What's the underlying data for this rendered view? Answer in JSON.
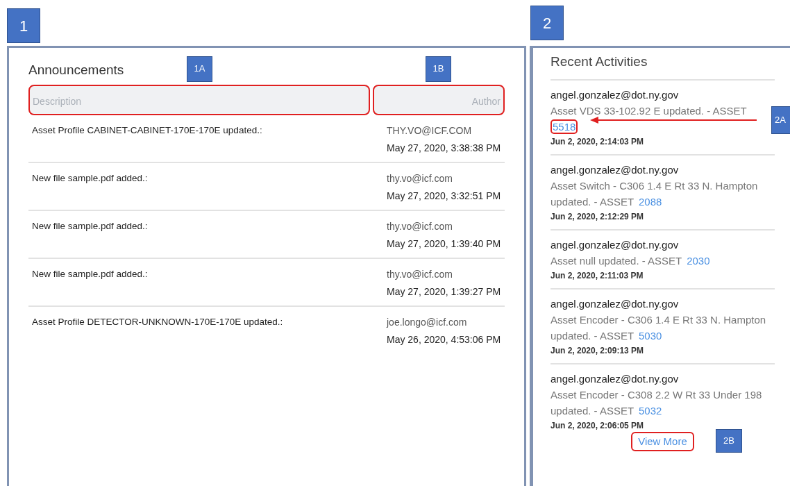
{
  "announcements": {
    "callout": "1",
    "title": "Announcements",
    "columns": [
      {
        "label": "Description",
        "callout": "1A",
        "highlighted": true
      },
      {
        "label": "Author",
        "callout": "1B",
        "highlighted": true
      }
    ],
    "rows": [
      {
        "description": "Asset Profile CABINET-CABINET-170E-170E updated.:",
        "author": "THY.VO@ICF.COM",
        "date": "May 27, 2020, 3:38:38 PM"
      },
      {
        "description": "New file sample.pdf added.:",
        "author": "thy.vo@icf.com",
        "date": "May 27, 2020, 3:32:51 PM"
      },
      {
        "description": "New file sample.pdf added.:",
        "author": "thy.vo@icf.com",
        "date": "May 27, 2020, 1:39:40 PM"
      },
      {
        "description": "New file sample.pdf added.:",
        "author": "thy.vo@icf.com",
        "date": "May 27, 2020, 1:39:27 PM"
      },
      {
        "description": "Asset Profile DETECTOR-UNKNOWN-170E-170E updated.:",
        "author": "joe.longo@icf.com",
        "date": "May 26, 2020, 4:53:06 PM"
      }
    ]
  },
  "activities": {
    "callout": "2",
    "title": "Recent Activities",
    "items": [
      {
        "user": "angel.gonzalez@dot.ny.gov",
        "text": "Asset VDS 33-102.92 E updated. - ASSET",
        "asset": "5518",
        "highlighted": true,
        "callout": "2A",
        "date": "Jun 2, 2020, 2:14:03 PM"
      },
      {
        "user": "angel.gonzalez@dot.ny.gov",
        "text": "Asset Switch - C306 1.4 E Rt 33 N. Hampton updated. - ASSET",
        "asset": "2088",
        "highlighted": false,
        "date": "Jun 2, 2020, 2:12:29 PM"
      },
      {
        "user": "angel.gonzalez@dot.ny.gov",
        "text": "Asset null updated. - ASSET",
        "asset": "2030",
        "highlighted": false,
        "date": "Jun 2, 2020, 2:11:03 PM"
      },
      {
        "user": "angel.gonzalez@dot.ny.gov",
        "text": "Asset Encoder - C306 1.4 E Rt 33 N. Hampton updated. - ASSET",
        "asset": "5030",
        "highlighted": false,
        "date": "Jun 2, 2020, 2:09:13 PM"
      },
      {
        "user": "angel.gonzalez@dot.ny.gov",
        "text": "Asset Encoder - C308 2.2 W Rt 33 Under 198 updated. - ASSET",
        "asset": "5032",
        "highlighted": false,
        "date": "Jun 2, 2020, 2:06:05 PM"
      }
    ],
    "view_more": {
      "label": "View More",
      "highlighted": true,
      "callout": "2B"
    }
  }
}
